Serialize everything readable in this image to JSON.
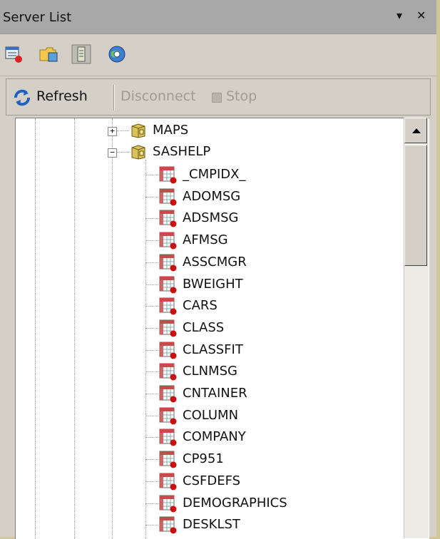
{
  "window": {
    "title": "Server List",
    "pin_glyph": "▾",
    "close_glyph": "✕"
  },
  "toolbar": {
    "icons": [
      "server-list-icon",
      "folder-icon",
      "server-icon",
      "globe-icon"
    ]
  },
  "commands": {
    "refresh": "Refresh",
    "disconnect": "Disconnect",
    "stop": "Stop"
  },
  "tree": {
    "libraries": [
      {
        "label": "MAPS",
        "expanded": false
      },
      {
        "label": "SASHELP",
        "expanded": true
      }
    ],
    "items": [
      "_CMPIDX_",
      "ADOMSG",
      "ADSMSG",
      "AFMSG",
      "ASSCMGR",
      "BWEIGHT",
      "CARS",
      "CLASS",
      "CLASSFIT",
      "CLNMSG",
      "CNTAINER",
      "COLUMN",
      "COMPANY",
      "CP951",
      "CSFDEFS",
      "DEMOGRAPHICS",
      "DESKLST"
    ]
  },
  "colors": {
    "title_bar": "#a8a8a8",
    "panel": "#d4d0c8",
    "outer_bg": "#cfc79a"
  }
}
